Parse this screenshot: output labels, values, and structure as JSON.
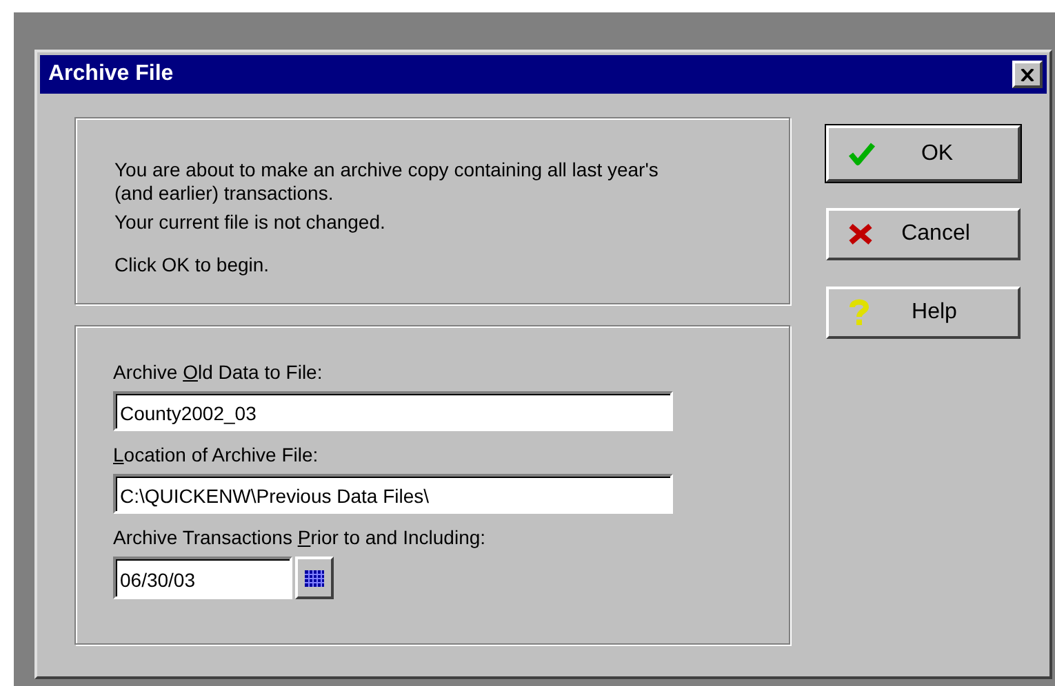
{
  "window": {
    "title": "Archive File"
  },
  "message": {
    "lines": [
      "You are about to make an archive copy containing all last year's (and earlier) transactions.",
      "Your current file is not changed.",
      "Click OK to begin."
    ]
  },
  "fields": [
    {
      "kind": "text",
      "label": {
        "before": "Archive ",
        "key": "O",
        "after": "ld Data to File:"
      },
      "value": "County2002_03"
    },
    {
      "kind": "text",
      "label": {
        "key": "L",
        "after": "ocation of Archive File:"
      },
      "value": "C:\\QUICKENW\\Previous Data Files\\"
    },
    {
      "kind": "date",
      "label": {
        "before": "Archive Transactions ",
        "key": "P",
        "after": "rior to and Including:"
      },
      "value": "06/30/03"
    }
  ],
  "buttons": [
    {
      "label": "OK",
      "kind": "ok",
      "default": true
    },
    {
      "label": "Cancel",
      "kind": "cancel",
      "default": false
    },
    {
      "label": "Help",
      "kind": "help",
      "default": false
    }
  ]
}
